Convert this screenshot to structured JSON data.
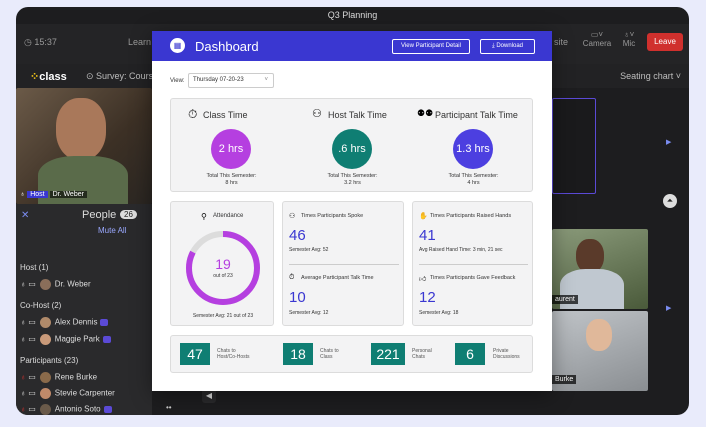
{
  "window": {
    "title": "Q3 Planning"
  },
  "toolbar": {
    "time": "15:37",
    "learn": "Learn",
    "site": "site",
    "camera": "Camera",
    "mic": "Mic",
    "leave": "Leave"
  },
  "subbar": {
    "logo": "class",
    "survey": "Survey: Course F",
    "seating": "Seating chart"
  },
  "video": {
    "host_tag": "Host",
    "host_name": "Dr. Weber",
    "name2": "aurent",
    "name3": "Burke"
  },
  "people": {
    "title": "People",
    "count": "26",
    "mute_all": "Mute All",
    "host_header": "Host (1)",
    "host_list": [
      "Dr. Weber"
    ],
    "cohost_header": "Co-Host (2)",
    "cohost_list": [
      "Alex Dennis",
      "Maggie Park"
    ],
    "participants_header": "Participants (23)",
    "participants_list": [
      "Rene Burke",
      "Stevie Carpenter",
      "Antonio Soto"
    ]
  },
  "modal": {
    "title": "Dashboard",
    "view_btn": "View Participant Detail",
    "download_btn": "Download",
    "view_label": "View:",
    "view_value": "Thursday 07-20-23"
  },
  "time_stats": [
    {
      "label": "Class Time",
      "value": "2 hrs",
      "sub1": "Total This Semester:",
      "sub2": "8 hrs",
      "color": "#b53fe0"
    },
    {
      "label": "Host Talk Time",
      "value": ".6 hrs",
      "sub1": "Total This Semester:",
      "sub2": "3.2 hrs",
      "color": "#0f7e73"
    },
    {
      "label": "Participant Talk Time",
      "value": "1.3 hrs",
      "sub1": "Total This Semester:",
      "sub2": "4 hrs",
      "color": "#4c3fe0"
    }
  ],
  "attendance": {
    "label": "Attendance",
    "value": "19",
    "sub": "out of 23",
    "avg": "Semester Avg: 21 out of 23",
    "fraction": 0.826
  },
  "spoke": {
    "label": "Times Participants Spoke",
    "value": "46",
    "avg": "Semester Avg: 52"
  },
  "avg_talk": {
    "label": "Average Participant Talk Time",
    "value": "10",
    "avg": "Semester Avg: 12"
  },
  "hands": {
    "label": "Times Participants Raised Hands",
    "value": "41",
    "avg": "Avg Raised Hand Time: 3 min, 21 sec"
  },
  "feedback": {
    "label": "Times Participants Gave Feedback",
    "value": "12",
    "avg": "Semester Avg: 18"
  },
  "chats": [
    {
      "value": "47",
      "label1": "Chats to",
      "label2": "Host/Co-Hosts"
    },
    {
      "value": "18",
      "label1": "Chats to",
      "label2": "Class"
    },
    {
      "value": "221",
      "label1": "Personal",
      "label2": "Chats"
    },
    {
      "value": "6",
      "label1": "Private",
      "label2": "Discussions"
    }
  ]
}
